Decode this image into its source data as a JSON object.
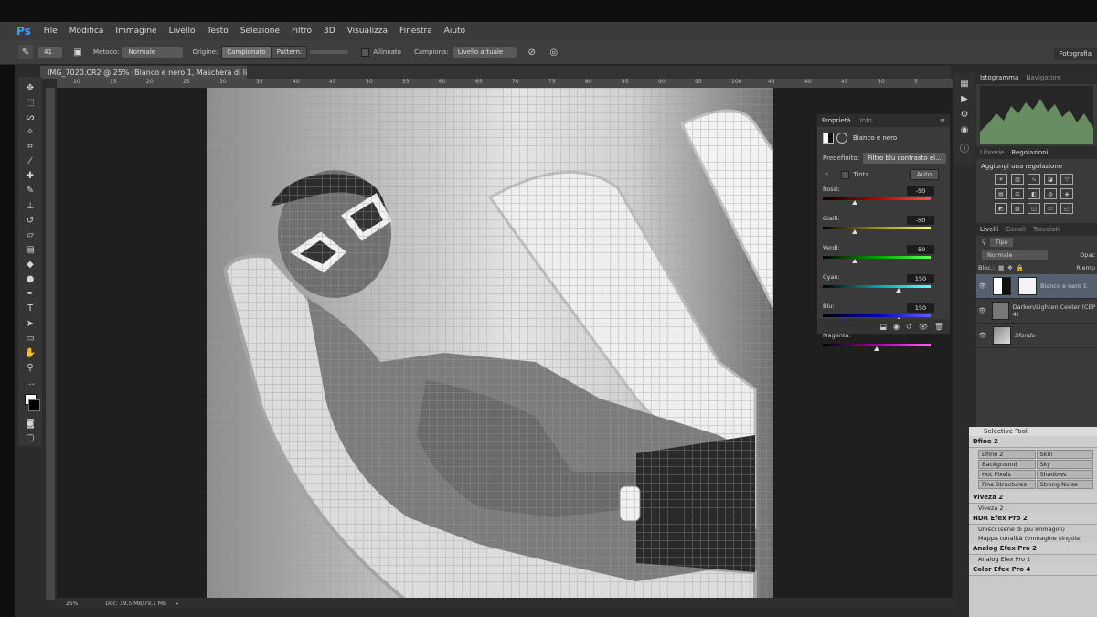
{
  "app": {
    "logo": "Ps"
  },
  "menu": [
    "File",
    "Modifica",
    "Immagine",
    "Livello",
    "Testo",
    "Selezione",
    "Filtro",
    "3D",
    "Visualizza",
    "Finestra",
    "Aiuto"
  ],
  "options": {
    "brush_size": "41",
    "metodo_label": "Metodo:",
    "metodo_value": "Normale",
    "origine_label": "Origine:",
    "campionato": "Campionato",
    "pattern": "Pattern:",
    "allineato": "Allineato",
    "campiona_label": "Campiona:",
    "campiona_value": "Livello attuale",
    "workspace": "Fotografia"
  },
  "document": {
    "tab": "IMG_7020.CR2 @ 25% (Bianco e nero 1, Maschera di livello/8) *"
  },
  "ruler": [
    "10",
    "15",
    "20",
    "25",
    "30",
    "35",
    "40",
    "45",
    "50",
    "55",
    "60",
    "65",
    "70",
    "75",
    "80",
    "85",
    "90",
    "95",
    "100",
    "45",
    "40",
    "45",
    "50",
    "5"
  ],
  "status": {
    "zoom": "25%",
    "doc": "Doc: 39,5 MB/79,1 MB"
  },
  "properties": {
    "tab_active": "Proprietà",
    "tab_inactive": "Info",
    "title": "Bianco e nero",
    "preset_label": "Predefinito:",
    "preset_value": "Filtro blu contrasto el...",
    "tint": "Tinta",
    "auto": "Auto",
    "sliders": [
      {
        "name": "Rossi:",
        "value": "-50",
        "pos": 0.3,
        "gradient": "linear-gradient(90deg,#000,#b00000,#ff5050)"
      },
      {
        "name": "Gialli:",
        "value": "-50",
        "pos": 0.3,
        "gradient": "linear-gradient(90deg,#000,#a09000,#ffff60)"
      },
      {
        "name": "Verdi:",
        "value": "-50",
        "pos": 0.3,
        "gradient": "linear-gradient(90deg,#000,#00a000,#60ff60)"
      },
      {
        "name": "Cyan:",
        "value": "150",
        "pos": 0.7,
        "gradient": "linear-gradient(90deg,#000,#00a0a0,#60ffff)"
      },
      {
        "name": "Blu:",
        "value": "150",
        "pos": 0.7,
        "gradient": "linear-gradient(90deg,#000,#0000c0,#6060ff)"
      },
      {
        "name": "Magenta:",
        "value": "",
        "pos": 0.5,
        "gradient": "linear-gradient(90deg,#000,#a000a0,#ff60ff)"
      }
    ]
  },
  "dock": {
    "histogram_tab": "Istogramma",
    "navigator_tab": "Navigatore",
    "libraries_tab": "Librerie",
    "adjustments_tab": "Regolazioni",
    "adjust_title": "Aggiungi una regolazione",
    "layers_tab": "Livelli",
    "channels_tab": "Canali",
    "paths_tab": "Tracciati",
    "kind": "Tipo",
    "blend": "Normale",
    "opacity": "Opac",
    "lock": "Bloc.:",
    "fill": "Riemp",
    "layers": [
      {
        "name": "Bianco e nero 1",
        "selected": true
      },
      {
        "name": "Darken/Lighten Center (CEP 4)",
        "selected": false
      },
      {
        "name": "Sfondo",
        "selected": false
      }
    ]
  },
  "selective_tool": {
    "title": "Selective Tool",
    "sections": [
      {
        "name": "Dfine 2",
        "buttons": [
          "Dfine 2",
          "Skin",
          "Background",
          "Sky",
          "Hot Pixels",
          "Shadows",
          "Fine Structures",
          "Strong Noise"
        ],
        "items": []
      },
      {
        "name": "Viveza 2",
        "buttons": [],
        "items": [
          "Viveza 2"
        ]
      },
      {
        "name": "HDR Efex Pro 2",
        "buttons": [],
        "items": [
          "Unisci (serie di più immagini)",
          "Mappa tonalità (immagine singola)"
        ]
      },
      {
        "name": "Analog Efex Pro 2",
        "buttons": [],
        "items": [
          "Analog Efex Pro 2"
        ]
      },
      {
        "name": "Color Efex Pro 4",
        "buttons": [],
        "items": []
      }
    ]
  }
}
